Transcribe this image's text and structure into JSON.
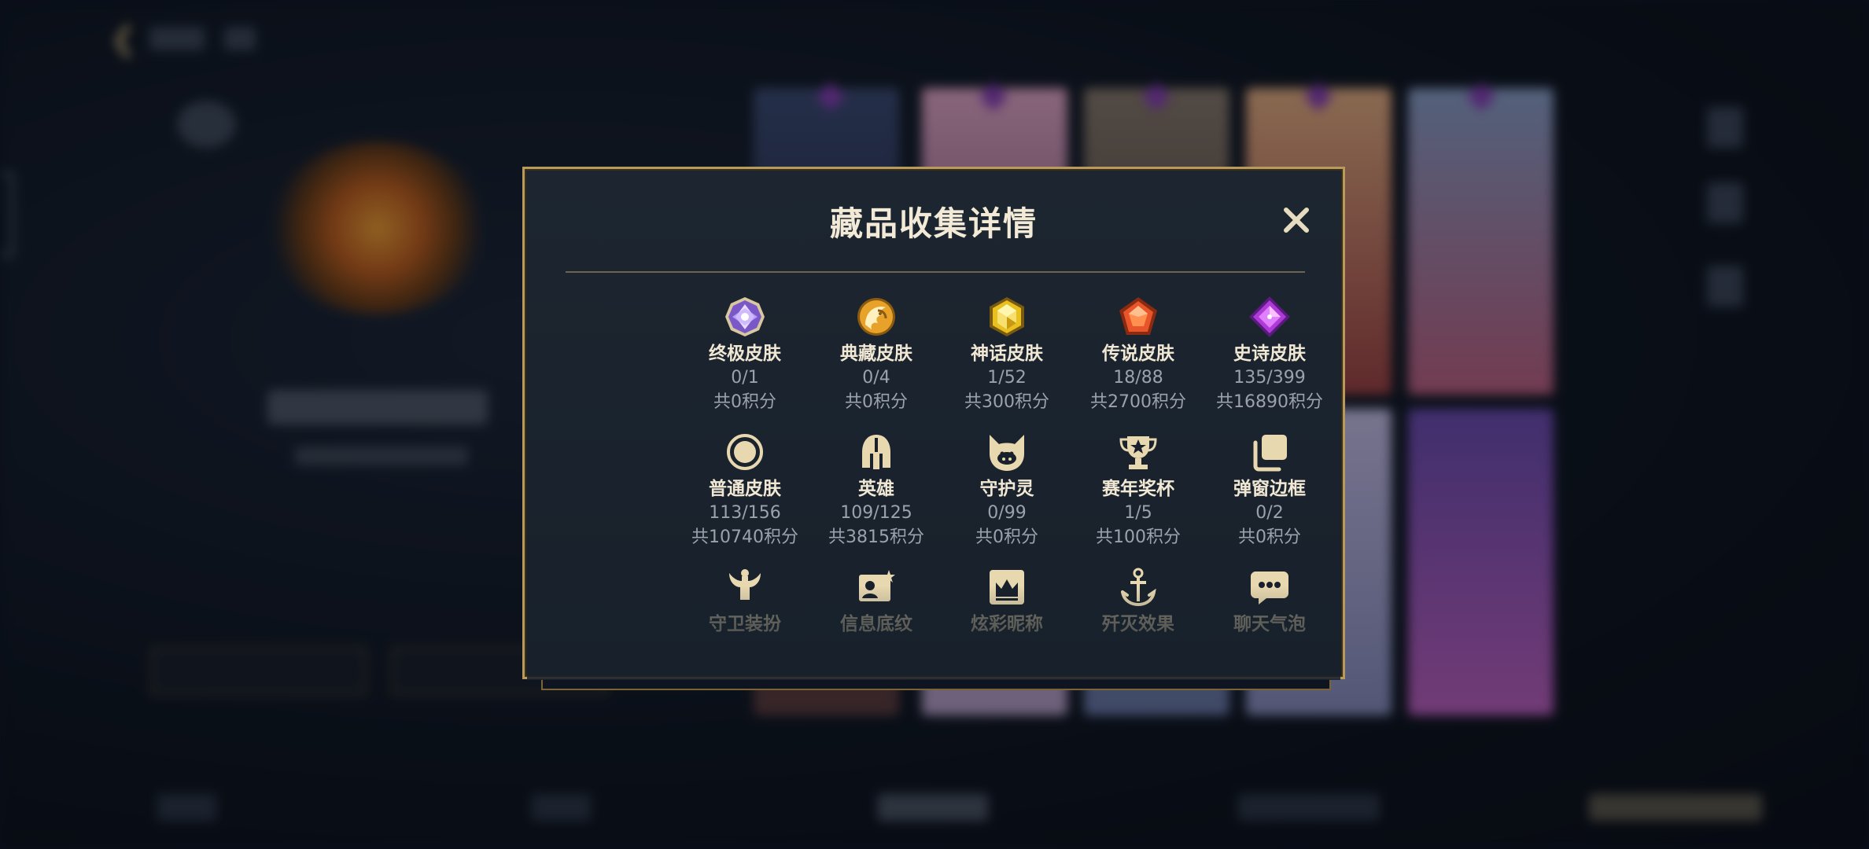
{
  "dialog": {
    "title": "藏品收集详情",
    "close_icon": "close-icon"
  },
  "rows": [
    [
      {
        "icon": "ultimate-skin-gem-icon",
        "name": "终极皮肤",
        "count": "0/1",
        "points": "共0积分",
        "color": "#b89cff"
      },
      {
        "icon": "prestige-skin-dragon-icon",
        "name": "典藏皮肤",
        "count": "0/4",
        "points": "共0积分",
        "color": "#e0a030"
      },
      {
        "icon": "mythic-skin-gem-icon",
        "name": "神话皮肤",
        "count": "1/52",
        "points": "共300积分",
        "color": "#e8c020"
      },
      {
        "icon": "legendary-skin-gem-icon",
        "name": "传说皮肤",
        "count": "18/88",
        "points": "共2700积分",
        "color": "#e8552a"
      },
      {
        "icon": "epic-skin-gem-icon",
        "name": "史诗皮肤",
        "count": "135/399",
        "points": "共16890积分",
        "color": "#b03ad8"
      }
    ],
    [
      {
        "icon": "common-skin-ring-icon",
        "name": "普通皮肤",
        "count": "113/156",
        "points": "共10740积分"
      },
      {
        "icon": "hero-helmet-icon",
        "name": "英雄",
        "count": "109/125",
        "points": "共3815积分"
      },
      {
        "icon": "guardian-spirit-icon",
        "name": "守护灵",
        "count": "0/99",
        "points": "共0积分"
      },
      {
        "icon": "season-trophy-icon",
        "name": "赛年奖杯",
        "count": "1/5",
        "points": "共100积分"
      },
      {
        "icon": "popup-frame-icon",
        "name": "弹窗边框",
        "count": "0/2",
        "points": "共0积分"
      }
    ],
    [
      {
        "icon": "guard-outfit-icon",
        "name": "守卫装扮"
      },
      {
        "icon": "profile-background-icon",
        "name": "信息底纹"
      },
      {
        "icon": "fancy-nickname-icon",
        "name": "炫彩昵称"
      },
      {
        "icon": "elimination-effect-icon",
        "name": "歼灭效果"
      },
      {
        "icon": "chat-bubble-icon",
        "name": "聊天气泡"
      }
    ]
  ],
  "colors": {
    "accent_gold": "#c9ad78",
    "border_gold": "#b89a5a",
    "panel": "#1b242e",
    "text_primary": "#f0e8d4",
    "text_secondary": "#9ba2ad"
  }
}
